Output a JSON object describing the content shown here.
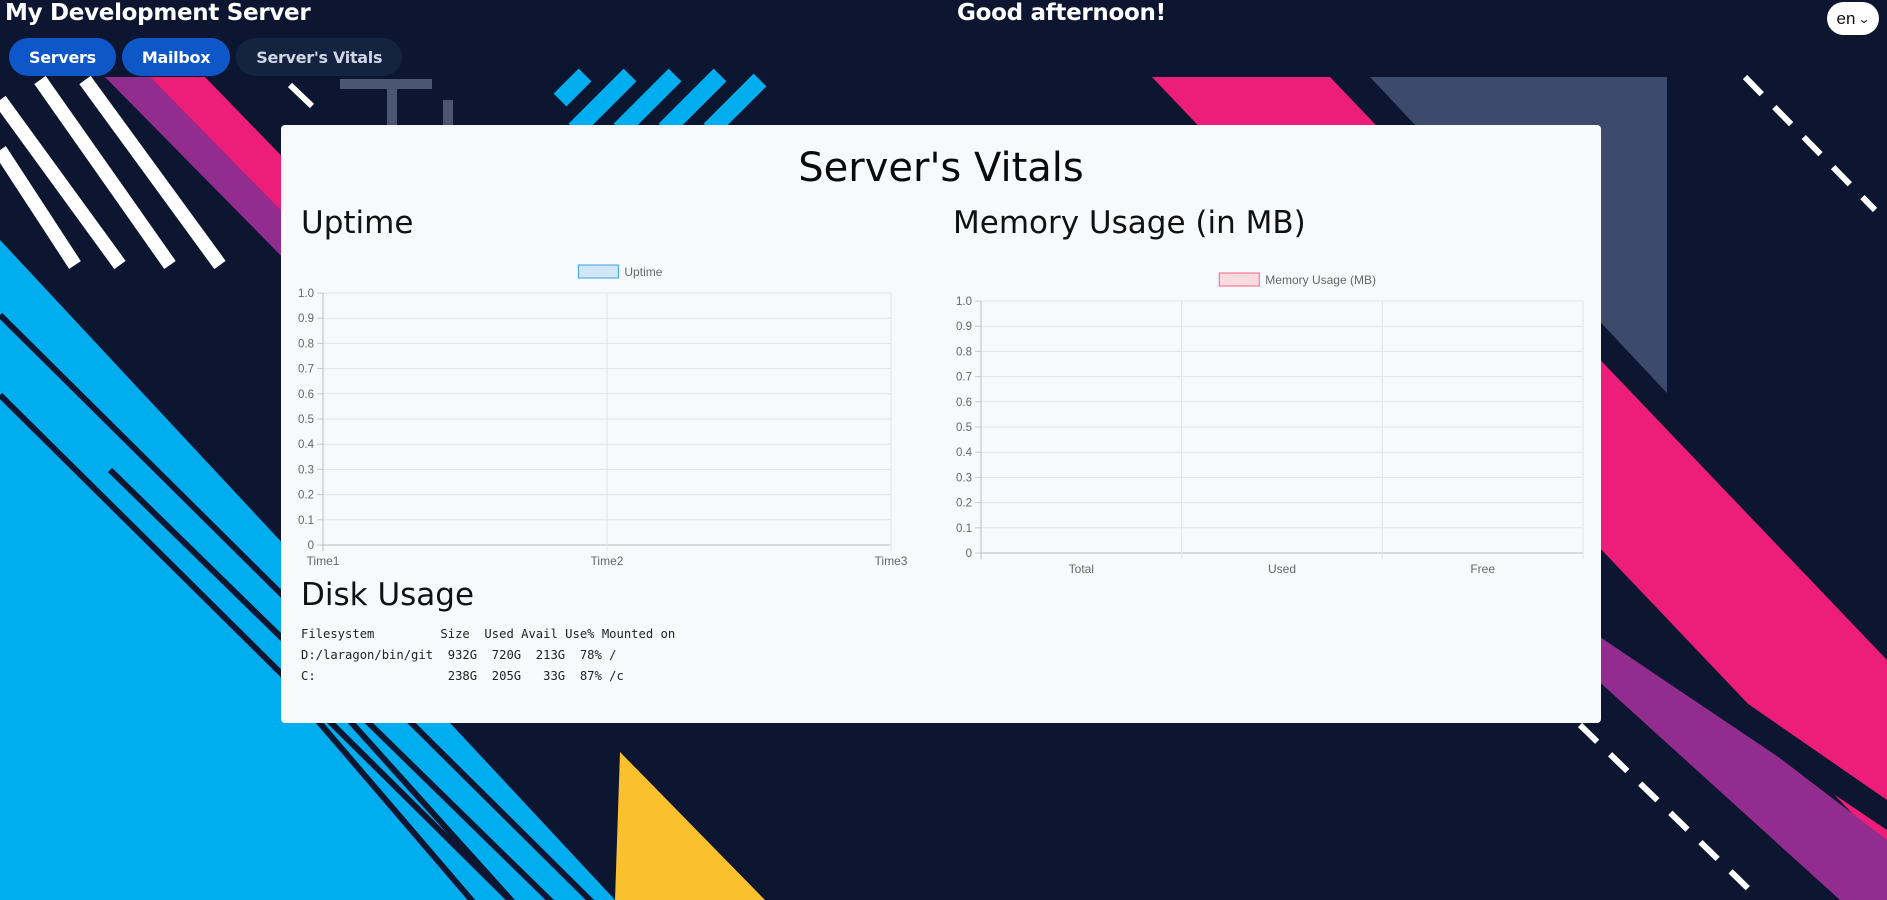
{
  "header": {
    "site_title": "My Development Server",
    "greeting": "Good afternoon!",
    "language": "en"
  },
  "nav": {
    "items": [
      {
        "label": "Servers",
        "active": false
      },
      {
        "label": "Mailbox",
        "active": false
      },
      {
        "label": "Server's Vitals",
        "active": true
      }
    ]
  },
  "page": {
    "title": "Server's Vitals",
    "uptime_heading": "Uptime",
    "memory_heading": "Memory Usage (in MB)",
    "disk_heading": "Disk Usage"
  },
  "chart_data": [
    {
      "type": "line",
      "legend": "Uptime",
      "legend_position": "top",
      "categories": [
        "Time1",
        "Time2",
        "Time3"
      ],
      "series": [
        {
          "name": "Uptime",
          "values": [
            null,
            null,
            null
          ]
        }
      ],
      "y_ticks": [
        "1.0",
        "0.9",
        "0.8",
        "0.7",
        "0.6",
        "0.5",
        "0.4",
        "0.3",
        "0.2",
        "0.1",
        "0"
      ],
      "ylim": [
        0,
        1
      ],
      "grid": true,
      "color": "#36a2eb"
    },
    {
      "type": "bar",
      "legend": "Memory Usage (MB)",
      "legend_position": "top",
      "categories": [
        "Total",
        "Used",
        "Free"
      ],
      "series": [
        {
          "name": "Memory Usage (MB)",
          "values": [
            null,
            null,
            null
          ]
        }
      ],
      "y_ticks": [
        "1.0",
        "0.9",
        "0.8",
        "0.7",
        "0.6",
        "0.5",
        "0.4",
        "0.3",
        "0.2",
        "0.1",
        "0"
      ],
      "ylim": [
        0,
        1
      ],
      "grid": true,
      "color": "#ff6384"
    }
  ],
  "disk_usage": {
    "lines": [
      "Filesystem         Size  Used Avail Use% Mounted on",
      "D:/laragon/bin/git  932G  720G  213G  78% /",
      "C:                  238G  205G   33G  87% /c"
    ]
  },
  "colors": {
    "background": "#0d1630",
    "nav_button": "#0d57c8",
    "nav_button_active": "#14233f",
    "card": "#f8f9fa",
    "accent_blue": "#00aeef",
    "accent_pink": "#ed1e79",
    "accent_purple": "#922c8e",
    "accent_yellow": "#fbc02d",
    "accent_slate": "#3e4a6b"
  }
}
